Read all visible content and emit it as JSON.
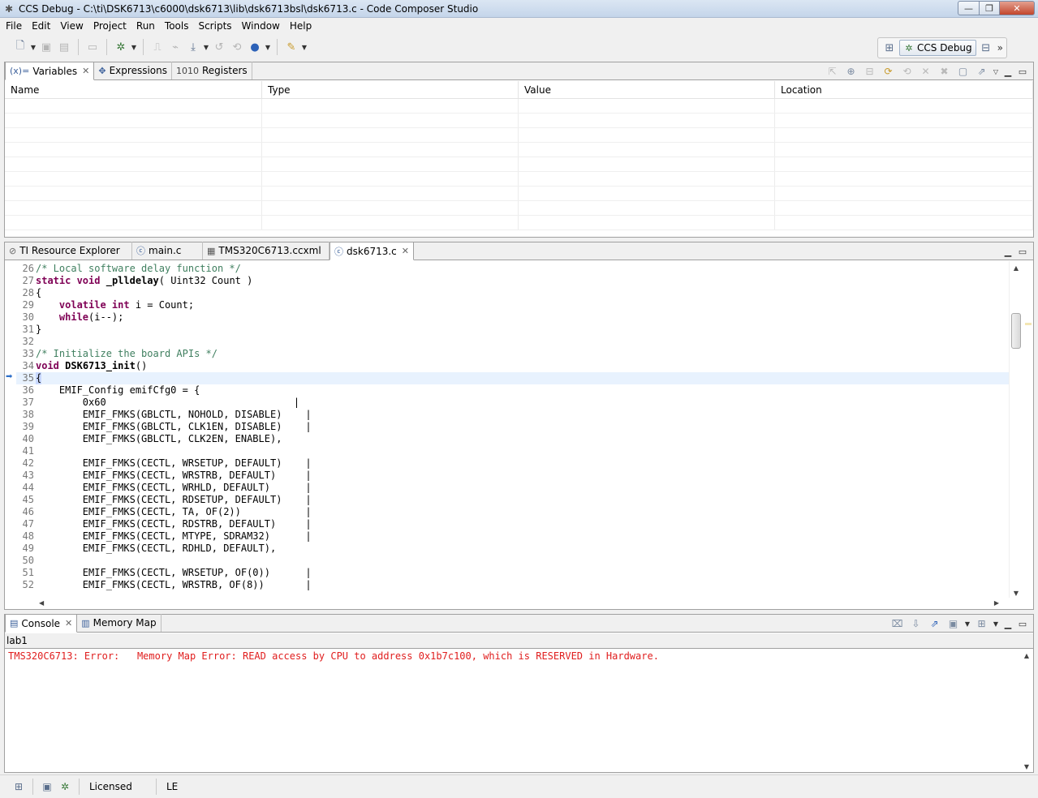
{
  "window": {
    "title": "CCS Debug - C:\\ti\\DSK6713\\c6000\\dsk6713\\lib\\dsk6713bsl\\dsk6713.c - Code Composer Studio",
    "buttons": {
      "minimize": "—",
      "maximize": "❐",
      "close": "✕"
    }
  },
  "menu": [
    "File",
    "Edit",
    "View",
    "Project",
    "Run",
    "Tools",
    "Scripts",
    "Window",
    "Help"
  ],
  "perspective": {
    "active": "CCS Debug",
    "more": "»"
  },
  "variables_view": {
    "tabs": [
      {
        "label": "Variables",
        "active": true,
        "icon": "variables-icon"
      },
      {
        "label": "Expressions",
        "active": false,
        "icon": "expressions-icon"
      },
      {
        "label": "Registers",
        "active": false,
        "icon": "registers-icon"
      }
    ],
    "columns": [
      "Name",
      "Type",
      "Value",
      "Location"
    ]
  },
  "editor": {
    "tabs": [
      {
        "label": "TI Resource Explorer",
        "active": false
      },
      {
        "label": "main.c",
        "active": false
      },
      {
        "label": "TMS320C6713.ccxml",
        "active": false
      },
      {
        "label": "dsk6713.c",
        "active": true
      }
    ],
    "lines": [
      {
        "num": "26",
        "segments": [
          {
            "t": "/* Local software delay function */",
            "s": "cmt"
          }
        ]
      },
      {
        "num": "27",
        "segments": [
          {
            "t": "static void",
            "s": "kw"
          },
          {
            "t": " ",
            "s": "txt"
          },
          {
            "t": "_plldelay",
            "s": "fn"
          },
          {
            "t": "( Uint32 Count )",
            "s": "txt"
          }
        ]
      },
      {
        "num": "28",
        "segments": [
          {
            "t": "{",
            "s": "txt"
          }
        ]
      },
      {
        "num": "29",
        "segments": [
          {
            "t": "    ",
            "s": "txt"
          },
          {
            "t": "volatile int",
            "s": "kw"
          },
          {
            "t": " i = Count;",
            "s": "txt"
          }
        ]
      },
      {
        "num": "30",
        "segments": [
          {
            "t": "    ",
            "s": "txt"
          },
          {
            "t": "while",
            "s": "kw"
          },
          {
            "t": "(i--);",
            "s": "txt"
          }
        ]
      },
      {
        "num": "31",
        "segments": [
          {
            "t": "}",
            "s": "txt"
          }
        ]
      },
      {
        "num": "32",
        "segments": []
      },
      {
        "num": "33",
        "segments": [
          {
            "t": "/* Initialize the board APIs */",
            "s": "cmt"
          }
        ]
      },
      {
        "num": "34",
        "segments": [
          {
            "t": "void",
            "s": "kw"
          },
          {
            "t": " ",
            "s": "txt"
          },
          {
            "t": "DSK6713_init",
            "s": "fn"
          },
          {
            "t": "()",
            "s": "txt"
          }
        ]
      },
      {
        "num": "35",
        "segments": [
          {
            "t": "{",
            "s": "txt"
          }
        ],
        "current": true
      },
      {
        "num": "36",
        "segments": [
          {
            "t": "    EMIF_Config emifCfg0 = {",
            "s": "txt"
          }
        ]
      },
      {
        "num": "37",
        "segments": [
          {
            "t": "        0x60                                |",
            "s": "txt"
          }
        ]
      },
      {
        "num": "38",
        "segments": [
          {
            "t": "        EMIF_FMKS(GBLCTL, NOHOLD, DISABLE)    |",
            "s": "txt"
          }
        ]
      },
      {
        "num": "39",
        "segments": [
          {
            "t": "        EMIF_FMKS(GBLCTL, CLK1EN, DISABLE)    |",
            "s": "txt"
          }
        ]
      },
      {
        "num": "40",
        "segments": [
          {
            "t": "        EMIF_FMKS(GBLCTL, CLK2EN, ENABLE),",
            "s": "txt"
          }
        ]
      },
      {
        "num": "41",
        "segments": []
      },
      {
        "num": "42",
        "segments": [
          {
            "t": "        EMIF_FMKS(CECTL, WRSETUP, DEFAULT)    |",
            "s": "txt"
          }
        ]
      },
      {
        "num": "43",
        "segments": [
          {
            "t": "        EMIF_FMKS(CECTL, WRSTRB, DEFAULT)     |",
            "s": "txt"
          }
        ]
      },
      {
        "num": "44",
        "segments": [
          {
            "t": "        EMIF_FMKS(CECTL, WRHLD, DEFAULT)      |",
            "s": "txt"
          }
        ]
      },
      {
        "num": "45",
        "segments": [
          {
            "t": "        EMIF_FMKS(CECTL, RDSETUP, DEFAULT)    |",
            "s": "txt"
          }
        ]
      },
      {
        "num": "46",
        "segments": [
          {
            "t": "        EMIF_FMKS(CECTL, TA, OF(2))           |",
            "s": "txt"
          }
        ]
      },
      {
        "num": "47",
        "segments": [
          {
            "t": "        EMIF_FMKS(CECTL, RDSTRB, DEFAULT)     |",
            "s": "txt"
          }
        ]
      },
      {
        "num": "48",
        "segments": [
          {
            "t": "        EMIF_FMKS(CECTL, MTYPE, SDRAM32)      |",
            "s": "txt"
          }
        ]
      },
      {
        "num": "49",
        "segments": [
          {
            "t": "        EMIF_FMKS(CECTL, RDHLD, DEFAULT),",
            "s": "txt"
          }
        ]
      },
      {
        "num": "50",
        "segments": []
      },
      {
        "num": "51",
        "segments": [
          {
            "t": "        EMIF_FMKS(CECTL, WRSETUP, OF(0))      |",
            "s": "txt"
          }
        ]
      },
      {
        "num": "52",
        "segments": [
          {
            "t": "        EMIF_FMKS(CECTL, WRSTRB, OF(8))       |",
            "s": "txt"
          }
        ]
      }
    ]
  },
  "console_view": {
    "tabs": [
      {
        "label": "Console",
        "active": true
      },
      {
        "label": "Memory Map",
        "active": false
      }
    ],
    "session": "lab1",
    "output": "TMS320C6713: Error:   Memory Map Error: READ access by CPU to address 0x1b7c100, which is RESERVED in Hardware.",
    "output_color": "#e01e1e"
  },
  "statusbar": {
    "license": "Licensed",
    "mode": "LE"
  },
  "colors": {
    "comment": "#3f7f5f",
    "keyword": "#7f0055",
    "current_line": "#e8f2fe"
  }
}
